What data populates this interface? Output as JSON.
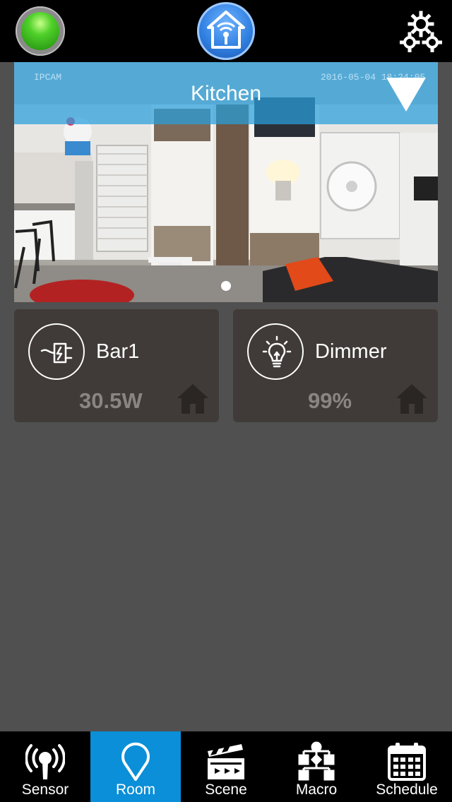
{
  "camera": {
    "room_name": "Kitchen",
    "osd_left": "IPCAM",
    "osd_right": "2016-05-04 18:24:05",
    "page_count": 1,
    "active_page": 1
  },
  "devices": [
    {
      "name": "Bar1",
      "value": "30.5W",
      "icon": "power-plug-icon"
    },
    {
      "name": "Dimmer",
      "value": "99%",
      "icon": "light-bulb-icon"
    }
  ],
  "tabs": [
    {
      "label": "Sensor",
      "icon": "sensor-antenna-icon",
      "active": false
    },
    {
      "label": "Room",
      "icon": "location-pin-icon",
      "active": true
    },
    {
      "label": "Scene",
      "icon": "clapperboard-icon",
      "active": false
    },
    {
      "label": "Macro",
      "icon": "flowchart-icon",
      "active": false
    },
    {
      "label": "Schedule",
      "icon": "calendar-icon",
      "active": false
    }
  ],
  "colors": {
    "background": "#505050",
    "card": "#403b38",
    "accent": "#0a8fd8",
    "status_light": "#4fd02a"
  }
}
